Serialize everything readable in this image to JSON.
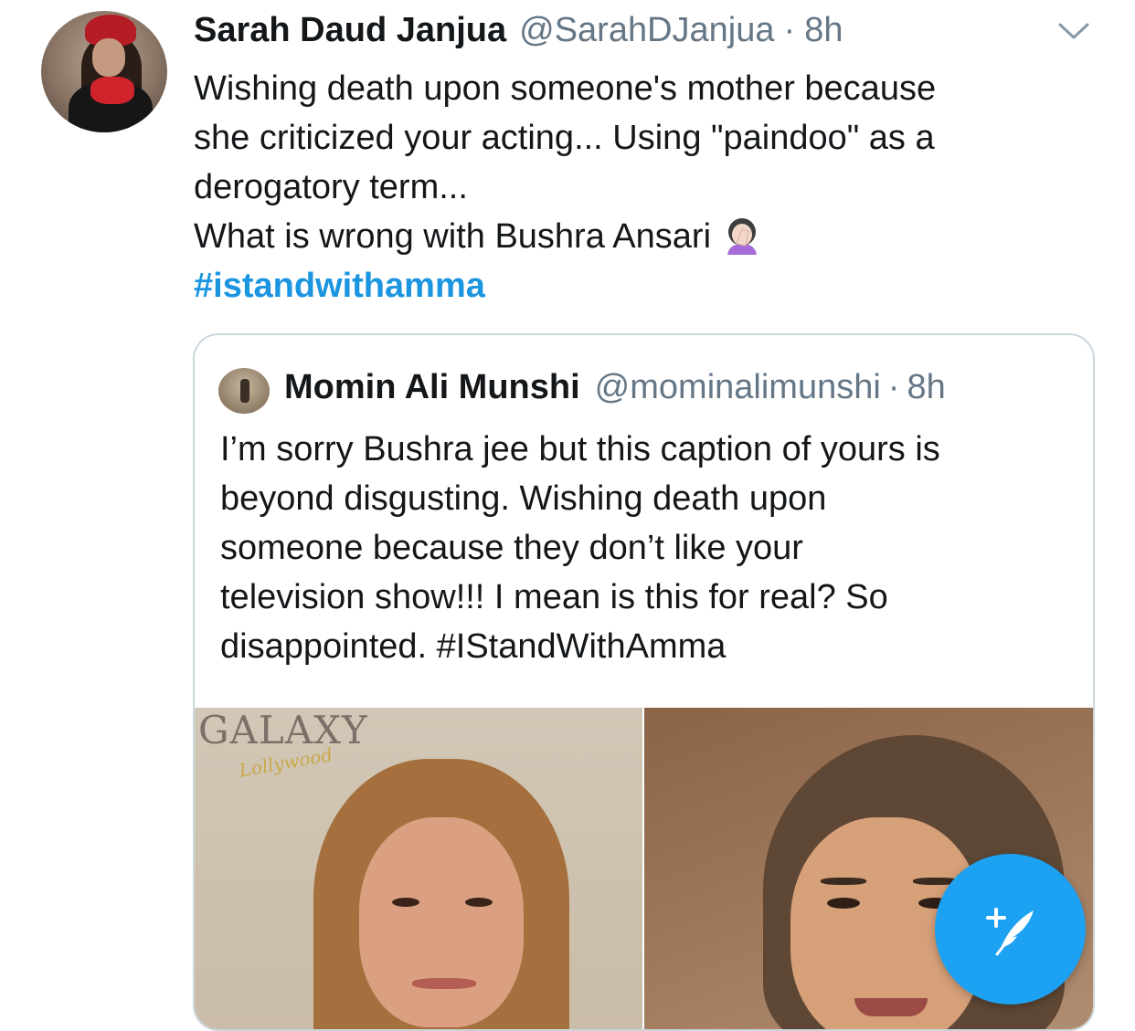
{
  "tweet": {
    "author_name": "Sarah Daud Janjua",
    "author_handle": "@SarahDJanjua",
    "separator": "·",
    "time": "8h",
    "lines": [
      "Wishing death upon someone's mother because",
      "she criticized your acting... Using \"paindoo\" as a",
      "derogatory term...",
      "What is wrong with Bushra Ansari"
    ],
    "emoji": "face-palm-woman-emoji",
    "hashtag": "#istandwithamma"
  },
  "quoted_tweet": {
    "author_name": "Momin Ali Munshi",
    "author_handle": "@mominalimunshi",
    "separator": "·",
    "time": "8h",
    "lines": [
      "I’m sorry Bushra jee but this caption of yours is",
      "beyond disgusting. Wishing death upon",
      "someone because they don’t like your",
      "television show!!! I mean is this for real? So",
      "disappointed. #IStandWithAmma"
    ],
    "media": {
      "watermark": "GALAXY",
      "watermark_sub": "Lollywood"
    }
  },
  "icons": {
    "menu": "chevron-down-icon",
    "compose": "compose-tweet-icon"
  },
  "colors": {
    "link": "#1b95e0",
    "secondary_text": "#657786",
    "fab": "#1da1f2",
    "border": "#ccd6dd"
  }
}
